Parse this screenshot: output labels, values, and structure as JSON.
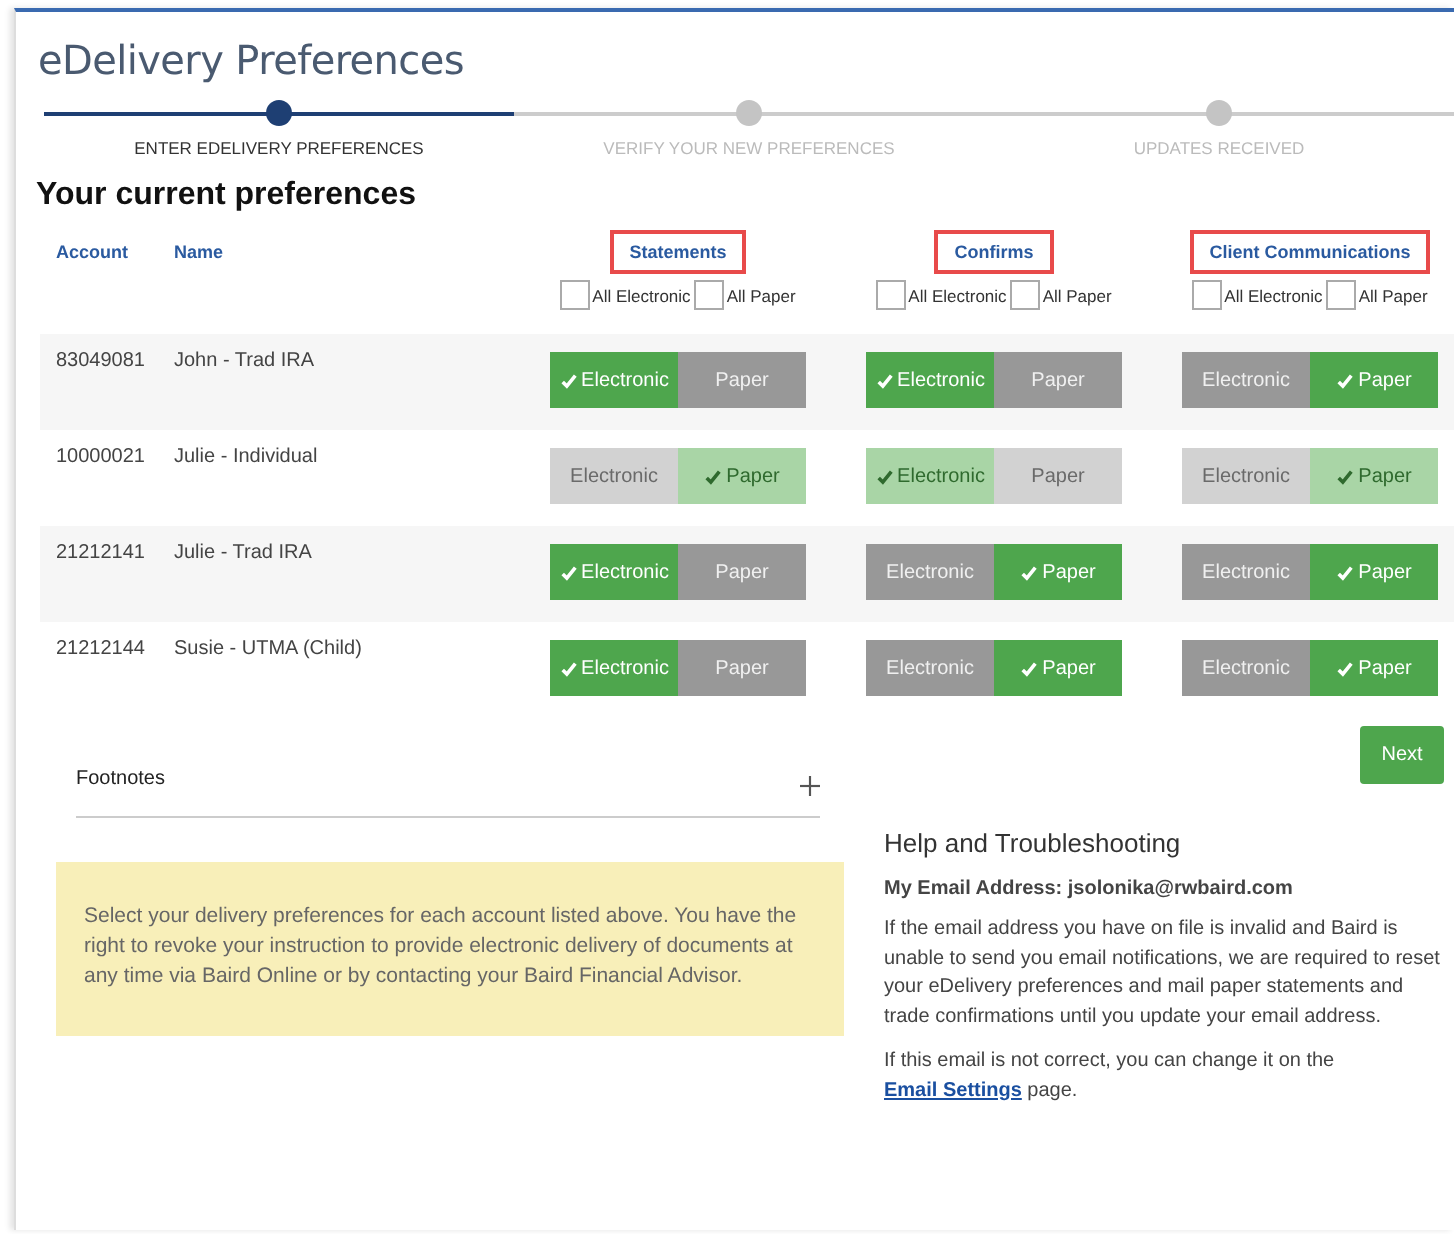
{
  "title": "eDelivery Preferences",
  "steps": [
    {
      "label": "ENTER EDELIVERY PREFERENCES",
      "selected": true
    },
    {
      "label": "VERIFY YOUR NEW PREFERENCES",
      "selected": false
    },
    {
      "label": "UPDATES RECEIVED",
      "selected": false
    }
  ],
  "heading": "Your current preferences",
  "table": {
    "columns": [
      {
        "label": "Account"
      },
      {
        "label": "Name"
      }
    ],
    "categories": [
      {
        "label": "Statements",
        "highlighted": true,
        "all": [
          {
            "label": "All Electronic",
            "checked": false
          },
          {
            "label": "All Paper",
            "checked": false
          }
        ]
      },
      {
        "label": "Confirms",
        "highlighted": true,
        "all": [
          {
            "label": "All Electronic",
            "checked": false
          },
          {
            "label": "All Paper",
            "checked": false
          }
        ]
      },
      {
        "label": "Client Communications",
        "highlighted": true,
        "all": [
          {
            "label": "All Electronic",
            "checked": false
          },
          {
            "label": "All Paper",
            "checked": false
          }
        ]
      }
    ],
    "rows": [
      {
        "account": "83049081",
        "name": "John - Trad IRA",
        "disabled": false,
        "prefs": [
          [
            {
              "label": "Electronic",
              "selected": true
            },
            {
              "label": "Paper",
              "selected": false
            }
          ],
          [
            {
              "label": "Electronic",
              "selected": true
            },
            {
              "label": "Paper",
              "selected": false
            }
          ],
          [
            {
              "label": "Electronic",
              "selected": false
            },
            {
              "label": "Paper",
              "selected": true
            }
          ]
        ]
      },
      {
        "account": "10000021",
        "name": "Julie - Individual",
        "disabled": true,
        "prefs": [
          [
            {
              "label": "Electronic",
              "selected": false
            },
            {
              "label": "Paper",
              "selected": true
            }
          ],
          [
            {
              "label": "Electronic",
              "selected": true
            },
            {
              "label": "Paper",
              "selected": false
            }
          ],
          [
            {
              "label": "Electronic",
              "selected": false
            },
            {
              "label": "Paper",
              "selected": true
            }
          ]
        ]
      },
      {
        "account": "21212141",
        "name": "Julie - Trad IRA",
        "disabled": false,
        "prefs": [
          [
            {
              "label": "Electronic",
              "selected": true
            },
            {
              "label": "Paper",
              "selected": false
            }
          ],
          [
            {
              "label": "Electronic",
              "selected": false
            },
            {
              "label": "Paper",
              "selected": true
            }
          ],
          [
            {
              "label": "Electronic",
              "selected": false
            },
            {
              "label": "Paper",
              "selected": true
            }
          ]
        ]
      },
      {
        "account": "21212144",
        "name": "Susie - UTMA (Child)",
        "disabled": false,
        "prefs": [
          [
            {
              "label": "Electronic",
              "selected": true
            },
            {
              "label": "Paper",
              "selected": false
            }
          ],
          [
            {
              "label": "Electronic",
              "selected": false
            },
            {
              "label": "Paper",
              "selected": true
            }
          ],
          [
            {
              "label": "Electronic",
              "selected": false
            },
            {
              "label": "Paper",
              "selected": true
            }
          ]
        ]
      }
    ]
  },
  "footnotes": {
    "label": "Footnotes",
    "expanded": false
  },
  "next_button": "Next",
  "notice": "Select your delivery preferences for each account listed above. You have the right to revoke your instruction to provide electronic delivery of documents at any time via Baird Online or by contacting your Baird Financial Advisor.",
  "help": {
    "title": "Help and Troubleshooting",
    "email_line": "My Email Address: jsolonika@rwbaird.com",
    "paragraph": "If the email address you have on file is invalid and Baird is unable to send you email notifications, we are required to reset your eDelivery preferences and mail paper statements and trade confirmations until you update your email address.",
    "change_text": "If this email is not correct, you can change it on the",
    "link": "Email Settings",
    "change_end": "page."
  }
}
